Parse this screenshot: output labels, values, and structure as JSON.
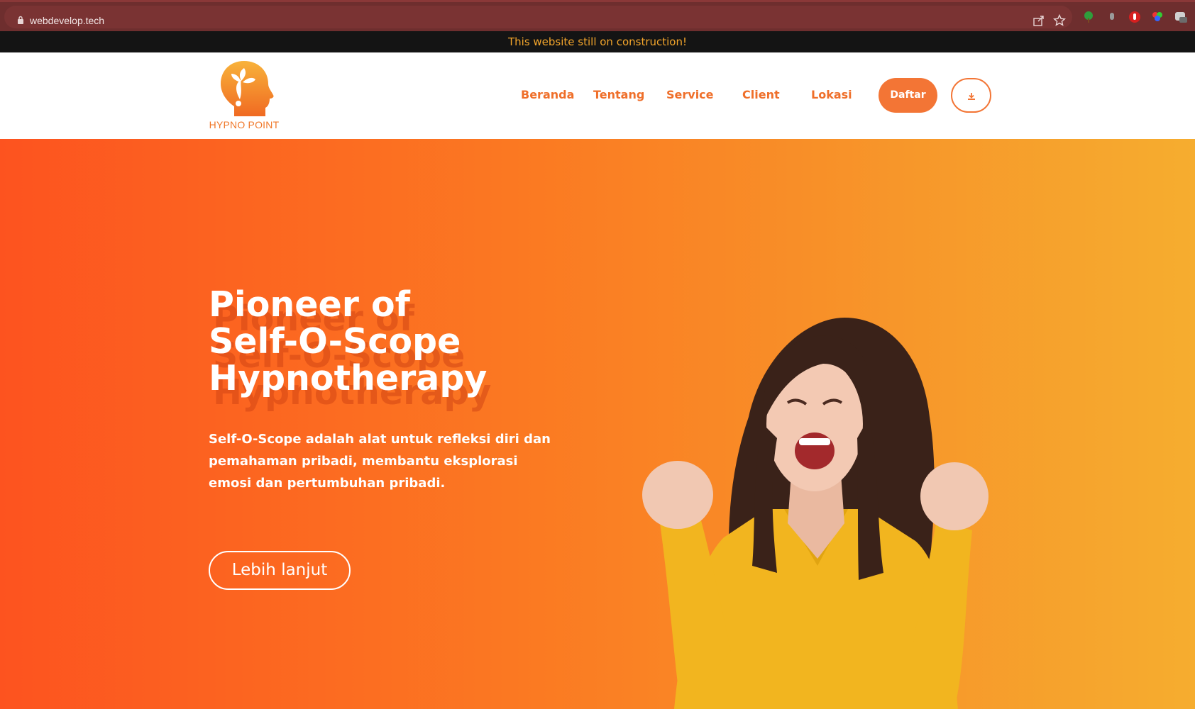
{
  "browser": {
    "url": "webdevelop.tech",
    "icons": [
      "share-icon",
      "star-icon",
      "extension-tree-icon",
      "extension-mic-icon",
      "extension-hand-icon",
      "extension-color-icon",
      "extension-off-icon"
    ],
    "accent": "#6e2e2e"
  },
  "notice": {
    "text": "This website still on construction!"
  },
  "header": {
    "logo_text": "HYPNO POINT",
    "nav": [
      {
        "label": "Beranda"
      },
      {
        "label": "Tentang"
      },
      {
        "label": "Service"
      },
      {
        "label": "Client"
      },
      {
        "label": "Lokasi"
      }
    ],
    "cta_label": "Daftar",
    "download_icon": "download-icon"
  },
  "hero": {
    "title": "Pioneer of\nSelf-O-Scope\nHypnotherapy",
    "description": "Self-O-Scope adalah alat untuk refleksi diri dan pemahaman pribadi, membantu eksplorasi emosi dan pertumbuhan pribadi.",
    "button_label": "Lebih lanjut",
    "image": "happy-woman-photo"
  },
  "colors": {
    "brand_orange": "#f37535",
    "notice_text": "#f3a52b",
    "gradient_start": "#fd531f",
    "gradient_end": "#f6ad2f"
  }
}
